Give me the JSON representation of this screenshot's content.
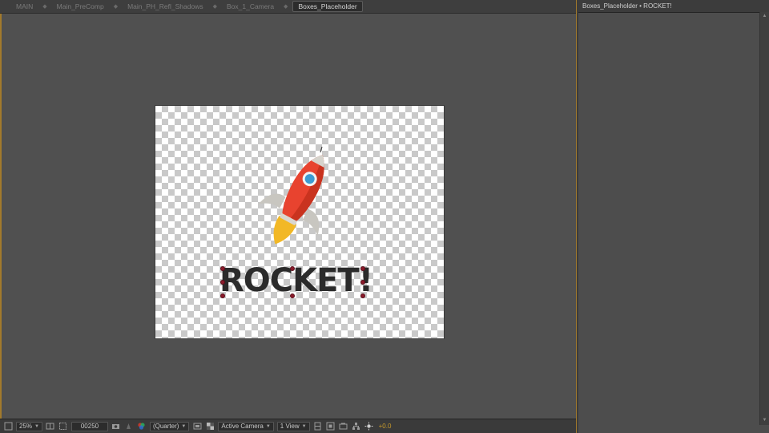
{
  "comp_breadcrumbs": [
    {
      "label": "MAIN",
      "active": false
    },
    {
      "label": "Main_PreComp",
      "active": false
    },
    {
      "label": "Main_PH_Refl_Shadows",
      "active": false
    },
    {
      "label": "Box_1_Camera",
      "active": false
    },
    {
      "label": "Boxes_Placeholder",
      "active": true
    }
  ],
  "composition": {
    "layer_text": "ROCKET!"
  },
  "statusbar": {
    "zoom": "25%",
    "timecode": "00250",
    "resolution": "(Quarter)",
    "camera": "Active Camera",
    "views": "1 View",
    "exposure": "+0.0"
  },
  "side_panel": {
    "title": "Boxes_Placeholder • ROCKET!"
  },
  "colors": {
    "accent": "#a27a2c",
    "rocket_body": "#e8432f",
    "rocket_flame": "#f2b826",
    "rocket_window": "#3d9bd1",
    "handle": "#8b1a2b"
  }
}
